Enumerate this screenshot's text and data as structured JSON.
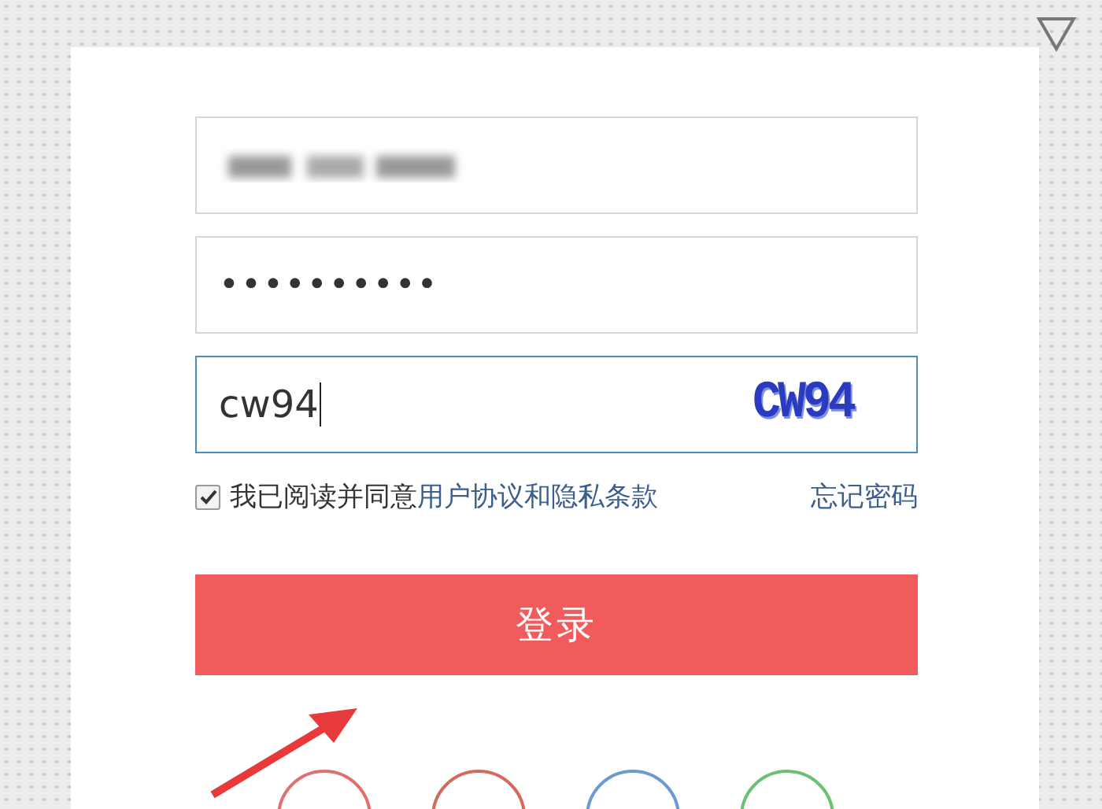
{
  "login_form": {
    "username": {
      "blurred": true
    },
    "password": {
      "value": "••••••••••"
    },
    "captcha": {
      "value": "cw94",
      "focused": true,
      "captcha_image_text": "CW94"
    },
    "agreement": {
      "checked": true,
      "label": "我已阅读并同意",
      "link": "用户协议和隐私条款"
    },
    "forgot_password": "忘记密码",
    "submit_button": "登录",
    "social_logins": [
      {
        "color": "#e07070"
      },
      {
        "color": "#d46a5a"
      },
      {
        "color": "#6a9ad4"
      },
      {
        "color": "#6cc070"
      }
    ]
  }
}
